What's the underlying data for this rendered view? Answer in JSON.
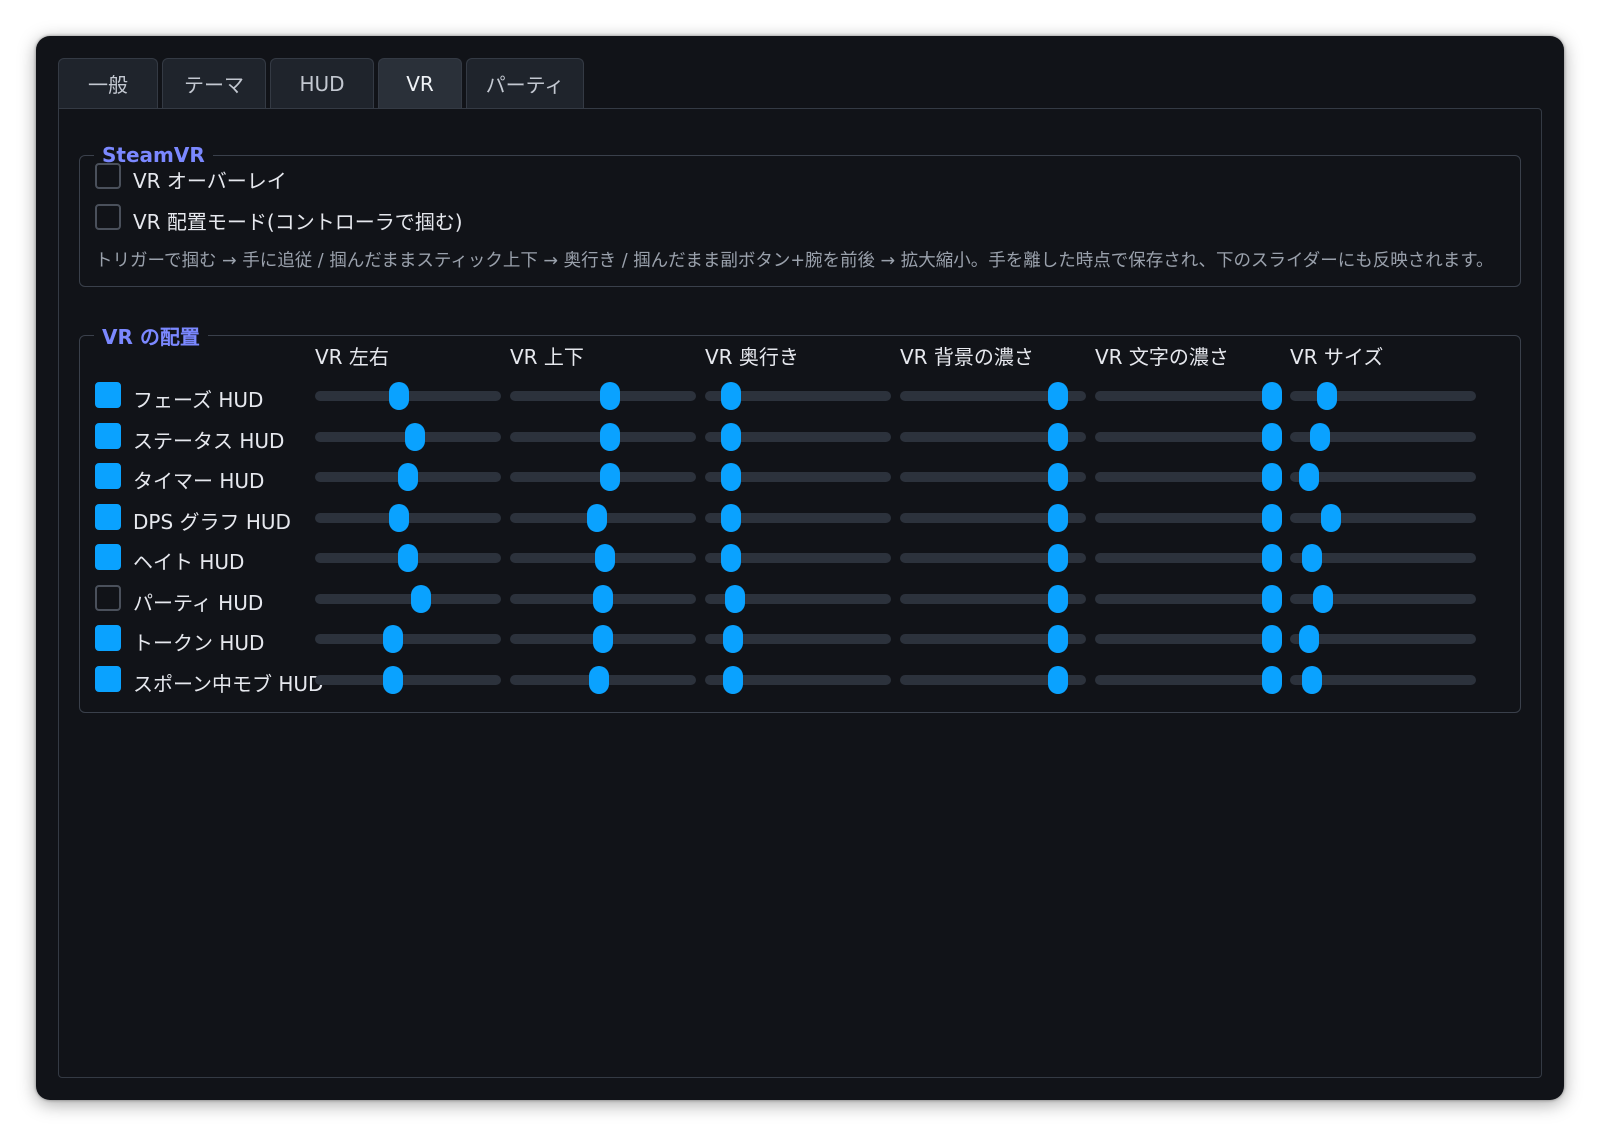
{
  "tabs": [
    {
      "label": "一般",
      "active": false
    },
    {
      "label": "テーマ",
      "active": false
    },
    {
      "label": "HUD",
      "active": false
    },
    {
      "label": "VR",
      "active": true
    },
    {
      "label": "パーティ",
      "active": false
    }
  ],
  "steamvr": {
    "legend": "SteamVR",
    "overlay": {
      "label": "VR オーバーレイ",
      "checked": false
    },
    "placement_mode": {
      "label": "VR 配置モード(コントローラで掴む)",
      "checked": false
    },
    "hint": "トリガーで掴む → 手に追従 / 掴んだままスティック上下 → 奥行き / 掴んだまま副ボタン+腕を前後 → 拡大縮小。手を離した時点で保存され、下のスライダーにも反映されます。"
  },
  "placement": {
    "legend": "VR の配置",
    "columns": [
      "VR 左右",
      "VR 上下",
      "VR 奥行き",
      "VR 背景の濃さ",
      "VR 文字の濃さ",
      "VR サイズ"
    ],
    "rows": [
      {
        "label": "フェーズ HUD",
        "checked": true,
        "values": [
          0.45,
          0.54,
          0.14,
          0.85,
          0.95,
          0.2
        ]
      },
      {
        "label": "ステータス HUD",
        "checked": true,
        "values": [
          0.54,
          0.54,
          0.14,
          0.85,
          0.95,
          0.16
        ]
      },
      {
        "label": "タイマー HUD",
        "checked": true,
        "values": [
          0.5,
          0.54,
          0.14,
          0.85,
          0.95,
          0.1
        ]
      },
      {
        "label": "DPS グラフ HUD",
        "checked": true,
        "values": [
          0.45,
          0.47,
          0.14,
          0.85,
          0.95,
          0.22
        ]
      },
      {
        "label": "ヘイト HUD",
        "checked": true,
        "values": [
          0.5,
          0.51,
          0.14,
          0.85,
          0.95,
          0.12
        ]
      },
      {
        "label": "パーティ HUD",
        "checked": false,
        "values": [
          0.57,
          0.5,
          0.16,
          0.85,
          0.95,
          0.18
        ]
      },
      {
        "label": "トークン HUD",
        "checked": true,
        "values": [
          0.42,
          0.5,
          0.15,
          0.85,
          0.95,
          0.1
        ]
      },
      {
        "label": "スポーン中モブ HUD",
        "checked": true,
        "values": [
          0.42,
          0.48,
          0.15,
          0.85,
          0.95,
          0.12
        ]
      }
    ]
  }
}
